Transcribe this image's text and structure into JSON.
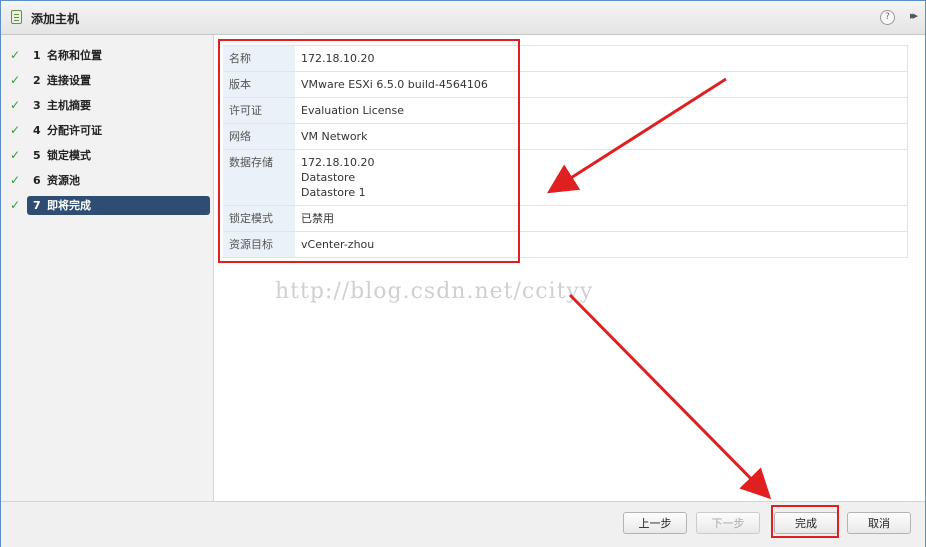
{
  "window": {
    "title": "添加主机",
    "help_icon": "help-icon",
    "expand_icon": "expand-icon",
    "help_glyph": "?",
    "expand_glyph": "▸▸"
  },
  "wizard": {
    "steps": [
      {
        "number": "1",
        "label": "名称和位置",
        "status": "done"
      },
      {
        "number": "2",
        "label": "连接设置",
        "status": "done"
      },
      {
        "number": "3",
        "label": "主机摘要",
        "status": "done"
      },
      {
        "number": "4",
        "label": "分配许可证",
        "status": "done"
      },
      {
        "number": "5",
        "label": "锁定模式",
        "status": "done"
      },
      {
        "number": "6",
        "label": "资源池",
        "status": "done"
      },
      {
        "number": "7",
        "label": "即将完成",
        "status": "active"
      }
    ],
    "check_glyph": "✓"
  },
  "summary": {
    "rows": [
      {
        "key": "名称",
        "value": "172.18.10.20"
      },
      {
        "key": "版本",
        "value": "VMware ESXi 6.5.0 build-4564106"
      },
      {
        "key": "许可证",
        "value": "Evaluation License"
      },
      {
        "key": "网络",
        "value": "VM Network"
      },
      {
        "key": "数据存储",
        "value": "172.18.10.20\nDatastore\nDatastore 1"
      },
      {
        "key": "锁定模式",
        "value": "已禁用"
      },
      {
        "key": "资源目标",
        "value": "vCenter-zhou"
      }
    ]
  },
  "watermark": "http://blog.csdn.net/ccityy",
  "footer": {
    "back_label": "上一步",
    "next_label": "下一步",
    "finish_label": "完成",
    "cancel_label": "取消"
  },
  "colors": {
    "accent": "#2f4d73",
    "check": "#3a9a3a",
    "annotation": "#e02020",
    "key_bg": "#eaf1f8"
  }
}
